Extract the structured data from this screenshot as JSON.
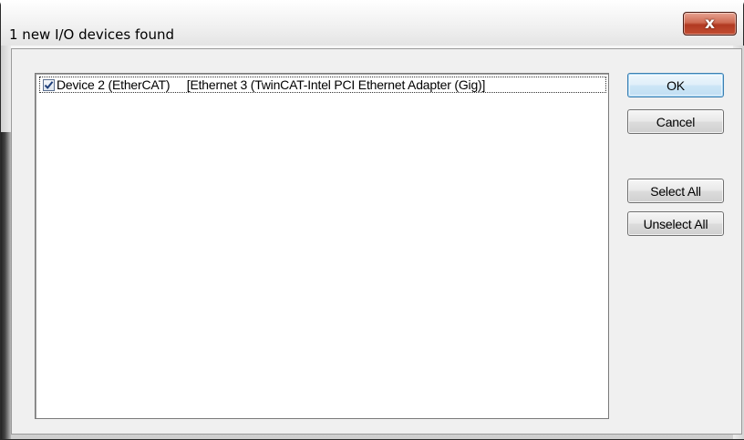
{
  "window": {
    "title": "1 new I/O devices found",
    "close_glyph": "x"
  },
  "device_list": {
    "items": [
      {
        "checked": true,
        "label": "Device 2 (EtherCAT)     [Ethernet 3 (TwinCAT-Intel PCI Ethernet Adapter (Gig)]"
      }
    ]
  },
  "buttons": {
    "ok": "OK",
    "cancel": "Cancel",
    "select_all": "Select All",
    "unselect_all": "Unselect All"
  },
  "icons": {
    "close": "close-icon",
    "checkmark": "checkmark-icon"
  },
  "colors": {
    "close_button": "#c34d32",
    "default_button_border": "#3c7fb1",
    "checkmark": "#1f3f7a"
  }
}
